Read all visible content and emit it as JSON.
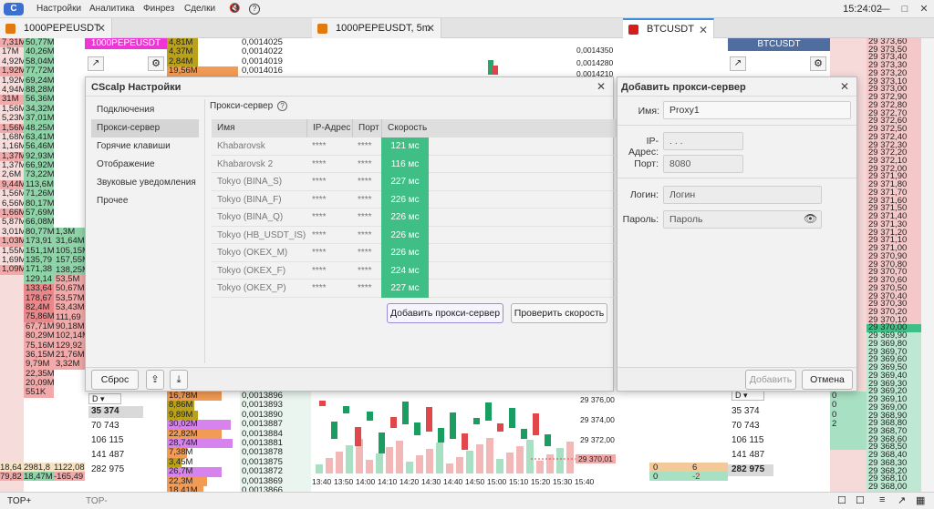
{
  "menu": {
    "items": [
      "Настройки",
      "Аналитика",
      "Финрез",
      "Сделки"
    ],
    "clock": "15:24:02"
  },
  "tabs": [
    {
      "label": "1000PEPEUSDT",
      "color": "#e07a10"
    },
    {
      "label": "1000PEPEUSDT, 5m",
      "color": "#e07a10"
    },
    {
      "label": "BTCUSDT",
      "color": "#d81b1b"
    }
  ],
  "left_volumes_a": [
    "7,31M",
    "17M",
    "4,92M",
    "1,92M",
    "1,92M",
    "4,94M",
    "31M",
    "1,56M",
    "5,23M",
    "1,56M",
    "1,68M",
    "1,16M",
    "1,37M",
    "1,37M",
    "2,6M",
    "9,44M",
    "1,56M",
    "6,56M",
    "1,66M",
    "5,87M",
    "3,01M",
    "1,03M",
    "1,55M",
    "1,69M",
    "1,09M"
  ],
  "left_volumes_b": [
    "50,77M",
    "40,26M",
    "58,04M",
    "77,72M",
    "69,24M",
    "88,28M",
    "56,36M",
    "34,32M",
    "37,01M",
    "48,25M",
    "63,41M",
    "56,46M",
    "92,93M",
    "66,92M",
    "73,22M",
    "113,6M",
    "71,26M",
    "80,17M",
    "57,69M",
    "66,08M",
    "80,77M",
    "173,91",
    "151,1M",
    "135,79",
    "171,38",
    "129,14",
    "133,64",
    "178,67",
    "82,4M",
    "75,86M",
    "67,71M",
    "80,29M",
    "75,16M",
    "36,15M",
    "9,79M",
    "22,35M",
    "20,09M",
    "551K"
  ],
  "left_volumes_c": [
    "1,3M",
    "31,64M",
    "105,15M",
    "157,55M",
    "138,25M",
    "53,5M",
    "50,67M",
    "53,57M",
    "53,43M",
    "111,69",
    "90,18M",
    "102,14M",
    "129,92",
    "21,76M",
    "3,32M"
  ],
  "left_bottom": [
    [
      "18,64",
      "2981,8",
      "1122,08"
    ],
    [
      "79,82",
      "18,47M",
      "-165,49"
    ]
  ],
  "pepe_prices_top": [
    "0,0014025",
    "0,0014022",
    "0,0014019",
    "0,0014016"
  ],
  "pepe_vols_top": [
    "4,81M",
    "4,37M",
    "2,84M",
    "19,56M"
  ],
  "pepe_prices_bottom": [
    "0,0013896",
    "0,0013893",
    "0,0013890",
    "0,0013887",
    "0,0013884",
    "0,0013881",
    "0,0013878",
    "0,0013875",
    "0,0013872",
    "0,0013869",
    "0,0013866",
    "0,0013863"
  ],
  "pepe_vols_bottom": [
    "16,78M",
    "8,86M",
    "9,89M",
    "30,02M",
    "22,82M",
    "28,74M",
    "7,38M",
    "3,45M",
    "26,7M",
    "22,3M",
    "18,41M",
    "2,75M"
  ],
  "pepe_orderbook_label": "1000PEPEUSDT",
  "chart_axis_top": [
    "0,0014350",
    "0,0014280",
    "0,0014210"
  ],
  "chart_axis_bottom": [
    "29 376,00",
    "29 374,00",
    "29 372,00"
  ],
  "chart_last_price": "29 370,01",
  "chart_times": [
    "13:40",
    "13:50",
    "14:00",
    "14:10",
    "14:20",
    "14:30",
    "14:40",
    "14:50",
    "15:00",
    "15:10",
    "15:20",
    "15:30",
    "15:40"
  ],
  "mid_stats": [
    "35 374",
    "70 743",
    "106 115",
    "141 487",
    "282 975"
  ],
  "btc_label": "BTCUSDT",
  "btc_prices": [
    "29 373,60",
    "29 373,50",
    "29 373,40",
    "29 373,30",
    "29 373,20",
    "29 373,10",
    "29 373,00",
    "29 372,90",
    "29 372,80",
    "29 372,70",
    "29 372,60",
    "29 372,50",
    "29 372,40",
    "29 372,30",
    "29 372,20",
    "29 372,10",
    "29 372,00",
    "29 371,90",
    "29 371,80",
    "29 371,70",
    "29 371,60",
    "29 371,50",
    "29 371,40",
    "29 371,30",
    "29 371,20",
    "29 371,10",
    "29 371,00",
    "29 370,90",
    "29 370,80",
    "29 370,70",
    "29 370,60",
    "29 370,50",
    "29 370,40",
    "29 370,30",
    "29 370,20",
    "29 370,10",
    "29 370,00",
    "29 369,90",
    "29 369,80",
    "29 369,70",
    "29 369,60",
    "29 369,50",
    "29 369,40",
    "29 369,30",
    "29 369,20",
    "29 369,10",
    "29 369,00",
    "29 368,90",
    "29 368,80",
    "29 368,70",
    "29 368,60",
    "29 368,50",
    "29 368,40",
    "29 368,30",
    "29 368,20",
    "29 368,10",
    "29 368,00"
  ],
  "btc_left_bottom": [
    "0",
    "0",
    "0",
    "2"
  ],
  "btc_mid_bottom": [
    [
      "0",
      "6"
    ],
    [
      "0",
      "-2"
    ]
  ],
  "btc_stats": [
    "35 374",
    "70 743",
    "106 115",
    "141 487",
    "282 975"
  ],
  "settings": {
    "title": "CScalp Настройки",
    "nav": [
      "Подключения",
      "Прокси-сервер",
      "Горячие клавиши",
      "Отображение",
      "Звуковые уведомления",
      "Прочее"
    ],
    "active_nav": 1,
    "section_title": "Прокси-сервер",
    "help_icon": "?",
    "table": {
      "headers": [
        "Имя",
        "IP-Адрес",
        "Порт",
        "Скорость"
      ],
      "rows": [
        {
          "name": "Khabarovsk",
          "ip": "****",
          "port": "****",
          "speed": "121 мс"
        },
        {
          "name": "Khabarovsk 2",
          "ip": "****",
          "port": "****",
          "speed": "116 мс"
        },
        {
          "name": "Tokyo (BINA_S)",
          "ip": "****",
          "port": "****",
          "speed": "227 мс"
        },
        {
          "name": "Tokyo (BINA_F)",
          "ip": "****",
          "port": "****",
          "speed": "226 мс"
        },
        {
          "name": "Tokyo (BINA_Q)",
          "ip": "****",
          "port": "****",
          "speed": "226 мс"
        },
        {
          "name": "Tokyo (HB_USDT_IS)",
          "ip": "****",
          "port": "****",
          "speed": "226 мс"
        },
        {
          "name": "Tokyo (OKEX_M)",
          "ip": "****",
          "port": "****",
          "speed": "226 мс"
        },
        {
          "name": "Tokyo (OKEX_F)",
          "ip": "****",
          "port": "****",
          "speed": "224 мс"
        },
        {
          "name": "Tokyo (OKEX_P)",
          "ip": "****",
          "port": "****",
          "speed": "227 мс"
        }
      ]
    },
    "add_button": "Добавить прокси-сервер",
    "check_button": "Проверить скорость",
    "reset_button": "Сброс"
  },
  "add_proxy": {
    "title": "Добавить прокси-сервер",
    "name_label": "Имя:",
    "name_value": "Proxy1",
    "ip_label": "IP-Адрес:",
    "ip_value": "  .    .    .",
    "port_label": "Порт:",
    "port_placeholder": "8080",
    "login_label": "Логин:",
    "login_placeholder": "Логин",
    "password_label": "Пароль:",
    "password_placeholder": "Пароль",
    "add_button": "Добавить",
    "cancel_button": "Отмена"
  },
  "bottom": {
    "top_plus": "TOP+",
    "top_minus": "TOP-"
  }
}
